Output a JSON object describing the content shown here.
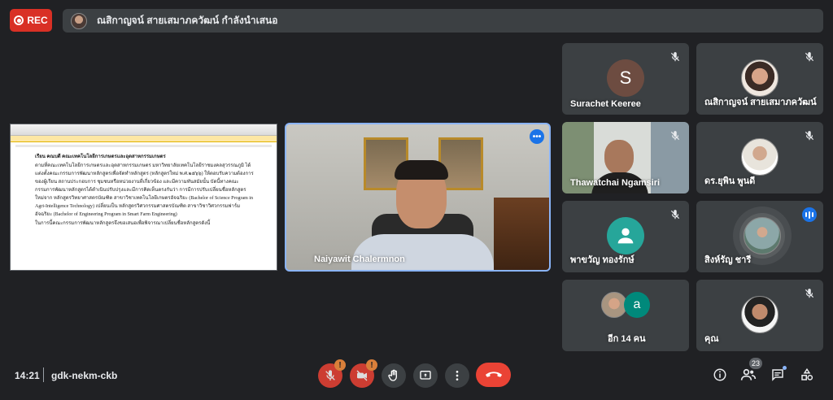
{
  "recording": {
    "label": "REC"
  },
  "presenter_bar": {
    "text": "ณสิกาญจน์ สายเสมาภควัฒน์ กำลังนำเสนอ"
  },
  "shared_document": {
    "heading": "เรียน คณบดี คณะเทคโนโลยีการเกษตรและอุตสาหกรรมเกษตร",
    "paragraph1": "ตามที่คณะเทคโนโลยีการเกษตรและอุตสาหกรรมเกษตร มหาวิทยาลัยเทคโนโลยีราชมงคลสุวรรณภูมิ ได้แต่งตั้งคณะกรรมการพัฒนาหลักสูตรเพื่อจัดทำหลักสูตร (หลักสูตรใหม่ พ.ศ.๒๕๖๖) ให้ตอบรับความต้องการของผู้เรียน สถานประกอบการ ชุมชนหรือหน่วยงานที่เกี่ยวข้อง และมีความทันสมัยนั้น บัดนี้ทางคณะกรรมการพัฒนาหลักสูตรได้ดำเนินปรับปรุงและมีการคิดเห็นตรงกันว่า การมีการปรับเปลี่ยนชื่อหลักสูตรใหม่จาก หลักสูตรวิทยาศาสตรบัณฑิต สาขาวิชาเทคโนโลยีเกษตรอัจฉริยะ (Bachelor of Science Program in Agri-Intelligence Technology) เปลี่ยนเป็น หลักสูตรวิศวกรรมศาสตรบัณฑิต สาขาวิชาวิศวกรรมฟาร์มอัจฉริยะ (Bachelor of Engineering Program in Smart Farm Engineering)",
    "paragraph2": "ในการนี้คณะกรรมการพัฒนาหลักสูตรจึงขอเสนอเพื่อพิจารณาเปลี่ยนชื่อหลักสูตรดังนี้"
  },
  "main_tile": {
    "name": "Naiyawit Chalermnon"
  },
  "participants": [
    {
      "name": "Surachet Keeree",
      "avatar_letter": "S",
      "avatar_color": "#6d4c41",
      "muted": true
    },
    {
      "name": "ณสิกาญจน์ สายเสมาภควัฒน์",
      "muted": true
    },
    {
      "name": "Thawatchai Ngamsiri",
      "muted": true
    },
    {
      "name": "ดร.ยุพิน พูนดี",
      "muted": true
    },
    {
      "name": "พาขวัญ ทองรักษ์",
      "muted": true
    },
    {
      "name": "สิงห์รัญ ชารี",
      "muted": false
    },
    {
      "name": "อีก 14 คน",
      "avatar_letter": "a",
      "avatar_color": "#00897b"
    },
    {
      "name": "คุณ",
      "muted": true
    }
  ],
  "bottom_bar": {
    "time": "14:21",
    "meeting_code": "gdk-nekm-ckb",
    "people_count": "23",
    "icons": {
      "mic": "mic-off-icon",
      "camera": "camera-off-icon",
      "hand": "raise-hand-icon",
      "present": "present-screen-icon",
      "more": "more-vert-icon",
      "hangup": "call-end-icon",
      "info": "info-icon",
      "people": "people-icon",
      "chat": "chat-icon",
      "activities": "activities-icon"
    },
    "warning_mark": "!"
  }
}
